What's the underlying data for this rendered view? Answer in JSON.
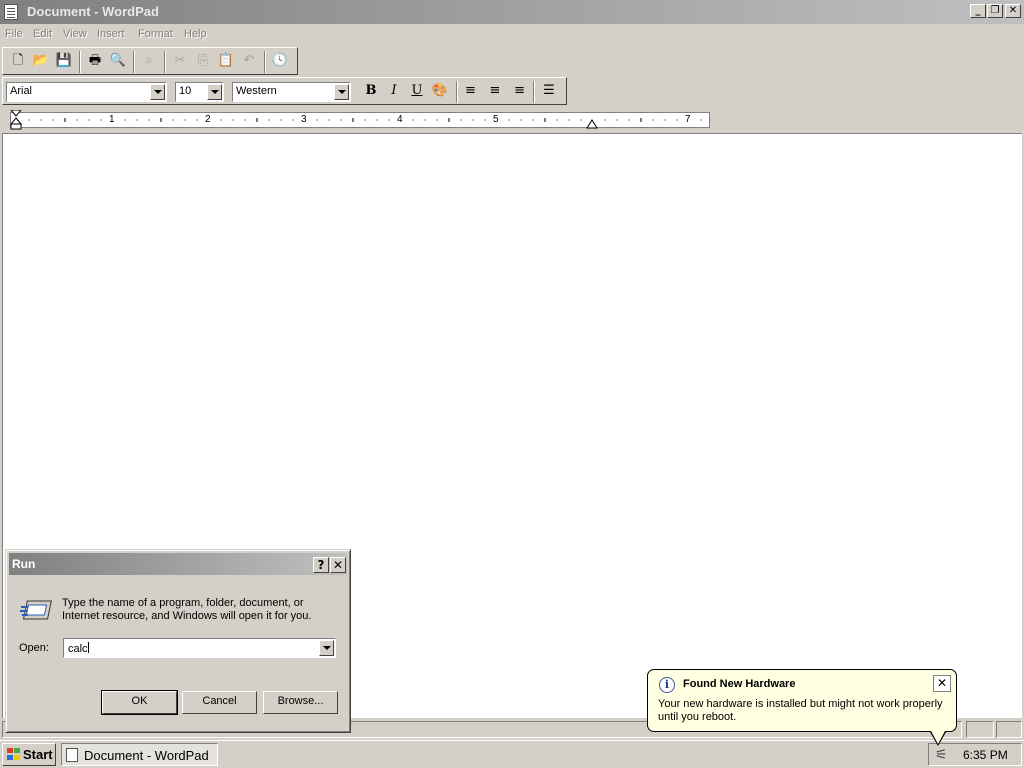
{
  "window": {
    "title": "Document - WordPad",
    "minimize_glyph": "_",
    "restore_glyph": "❐",
    "close_glyph": "✕"
  },
  "menu": [
    {
      "label": "File"
    },
    {
      "label": "Edit"
    },
    {
      "label": "View"
    },
    {
      "label": "Insert"
    },
    {
      "label": "Format"
    },
    {
      "label": "Help"
    }
  ],
  "toolbar": {
    "buttons": [
      {
        "name": "new",
        "glyph": "🗋"
      },
      {
        "name": "open",
        "glyph": "📂"
      },
      {
        "name": "save",
        "glyph": "💾"
      },
      {
        "name": "print",
        "glyph": "🖶"
      },
      {
        "name": "print-preview",
        "glyph": "🔍"
      },
      {
        "name": "find",
        "glyph": "⌕"
      },
      {
        "name": "cut",
        "glyph": "✂"
      },
      {
        "name": "copy",
        "glyph": "⎘"
      },
      {
        "name": "paste",
        "glyph": "📋"
      },
      {
        "name": "undo",
        "glyph": "↶"
      },
      {
        "name": "date-time",
        "glyph": "🕓"
      }
    ]
  },
  "format_bar": {
    "font": "Arial",
    "size": "10",
    "script": "Western",
    "bold": "B",
    "italic": "I",
    "underline": "U",
    "color_glyph": "🎨",
    "align_left_glyph": "≡",
    "align_center_glyph": "≡",
    "align_right_glyph": "≡",
    "bullets_glyph": "☰"
  },
  "ruler": {
    "labels": [
      "1",
      "2",
      "3",
      "4",
      "5",
      "7"
    ]
  },
  "run_dialog": {
    "title": "Run",
    "help_glyph": "?",
    "close_glyph": "✕",
    "description": "Type the name of a program, folder, document, or Internet resource, and Windows will open it for you.",
    "open_label": "Open:",
    "open_value": "calc",
    "ok": "OK",
    "cancel": "Cancel",
    "browse": "Browse..."
  },
  "balloon": {
    "icon_glyph": "i",
    "title": "Found New Hardware",
    "text": "Your new hardware is installed but might not work properly until you reboot.",
    "close_glyph": "✕"
  },
  "taskbar": {
    "start_label": "Start",
    "task_label": "Document - WordPad",
    "clock": "6:35 PM",
    "tray_icon_glyph": "⚟"
  },
  "colors": {
    "balloon_bg": "#ffffe1",
    "titlebar_inactive": "#808080",
    "face": "#d4d0c8"
  }
}
